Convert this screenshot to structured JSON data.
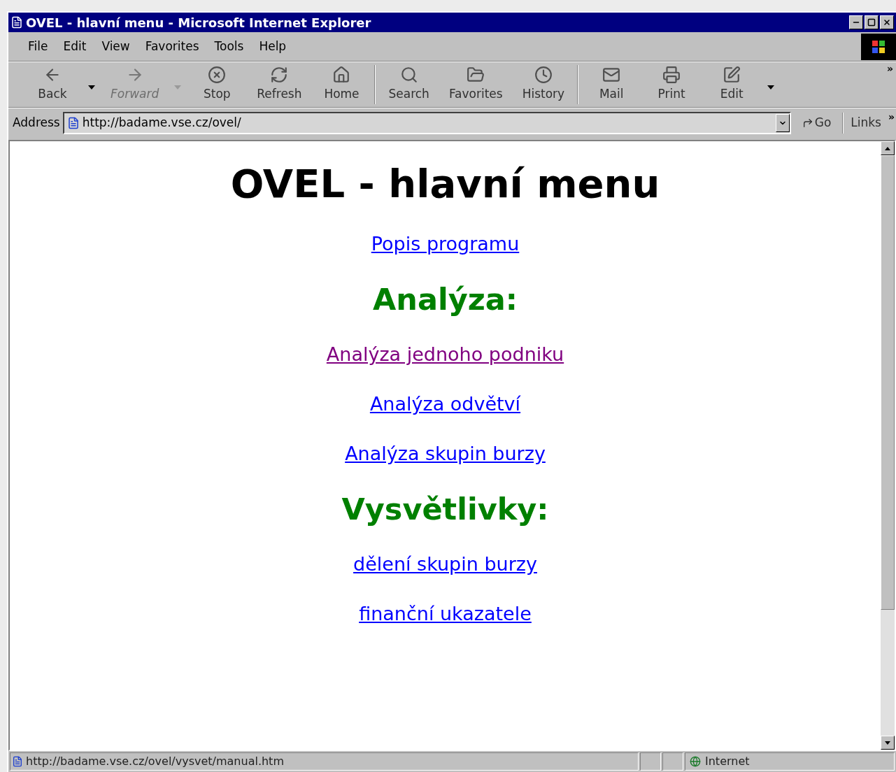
{
  "window": {
    "title": "OVEL - hlavní menu - Microsoft Internet Explorer"
  },
  "menu": [
    "File",
    "Edit",
    "View",
    "Favorites",
    "Tools",
    "Help"
  ],
  "toolbar": [
    {
      "kind": "button",
      "label": "Back",
      "disabled": false
    },
    {
      "kind": "caret",
      "disabled": false
    },
    {
      "kind": "button",
      "label": "Forward",
      "disabled": true
    },
    {
      "kind": "caret",
      "disabled": true
    },
    {
      "kind": "button",
      "label": "Stop",
      "disabled": false
    },
    {
      "kind": "button",
      "label": "Refresh",
      "disabled": false
    },
    {
      "kind": "button",
      "label": "Home",
      "disabled": false
    },
    {
      "kind": "separator"
    },
    {
      "kind": "button",
      "label": "Search",
      "disabled": false
    },
    {
      "kind": "button",
      "label": "Favorites",
      "disabled": false
    },
    {
      "kind": "button",
      "label": "History",
      "disabled": false
    },
    {
      "kind": "separator"
    },
    {
      "kind": "button",
      "label": "Mail",
      "disabled": false
    },
    {
      "kind": "button",
      "label": "Print",
      "disabled": false
    },
    {
      "kind": "button",
      "label": "Edit",
      "disabled": false
    },
    {
      "kind": "caret",
      "disabled": false
    }
  ],
  "toolbar_more": "»",
  "address": {
    "label": "Address",
    "value": "http://badame.vse.cz/ovel/",
    "go": "Go",
    "links": "Links",
    "links_more": "»"
  },
  "page": {
    "heading": "OVEL - hlavní menu",
    "items": [
      {
        "kind": "link",
        "text": "Popis programu",
        "visited": false
      },
      {
        "kind": "heading",
        "text": "Analýza:"
      },
      {
        "kind": "link",
        "text": "Analýza jednoho podniku",
        "visited": true
      },
      {
        "kind": "link",
        "text": "Analýza odvětví",
        "visited": false
      },
      {
        "kind": "link",
        "text": "Analýza skupin burzy",
        "visited": false
      },
      {
        "kind": "heading",
        "text": "Vysvětlivky:"
      },
      {
        "kind": "link",
        "text": "dělení skupin burzy",
        "visited": false
      },
      {
        "kind": "link",
        "text": "finanční ukazatele",
        "visited": false
      }
    ]
  },
  "status_bar": {
    "text": "http://badame.vse.cz/ovel/vysvet/manual.htm",
    "zone": "Internet"
  }
}
